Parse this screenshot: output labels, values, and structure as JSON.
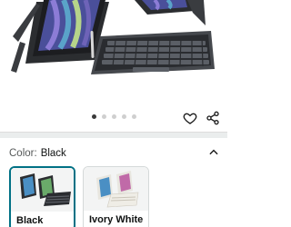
{
  "product": {
    "carousel": {
      "count": 5,
      "active_index": 0
    }
  },
  "icons": {
    "wishlist": "heart-outline-icon",
    "share": "share-icon",
    "collapse": "chevron-up-icon"
  },
  "variation": {
    "label": "Color:",
    "selected_value": "Black",
    "options": [
      {
        "name": "Black",
        "selected": true
      },
      {
        "name": "Ivory White",
        "selected": false
      }
    ]
  },
  "colors": {
    "accent": "#007185",
    "dot_active": "#3a3a3a",
    "dot_inactive": "#cfcfcf"
  }
}
